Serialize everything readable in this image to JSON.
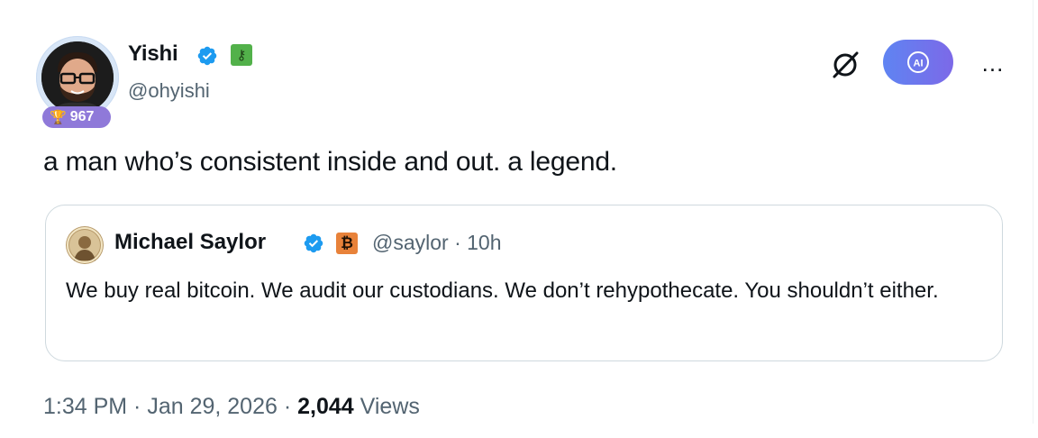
{
  "author": {
    "display_name": "Yishi",
    "handle": "@ohyishi",
    "rank": "967",
    "icons": [
      "verified-badge-icon",
      "key-badge-icon",
      "trophy-icon"
    ]
  },
  "header_actions": {
    "icons": [
      "grok-icon",
      "ai-icon",
      "more-icon"
    ],
    "ai_label": "AI",
    "more_label": "..."
  },
  "tweet": {
    "text": "a man who’s consistent inside and out. a legend."
  },
  "quote": {
    "display_name": "Michael Saylor",
    "handle_time": "@saylor · 10h",
    "text": "We buy real bitcoin. We audit our custodians. We don’t rehypothecate. You shouldn’t either.",
    "icons": [
      "verified-badge-icon",
      "bitcoin-badge-icon"
    ],
    "btc_glyph": "₿"
  },
  "meta": {
    "time": "1:34 PM",
    "sep1": " · ",
    "date": "Jan 29, 2026",
    "sep2": " · ",
    "views": "2,044",
    "views_label": " Views"
  },
  "colors": {
    "verified_blue": "#1d9bf0",
    "ai_gradient_start": "#5f84f2",
    "ai_gradient_end": "#7c69e8",
    "rank_badge": "#8f79d9",
    "key_badge": "#52b14a",
    "btc_badge": "#e8823a"
  }
}
